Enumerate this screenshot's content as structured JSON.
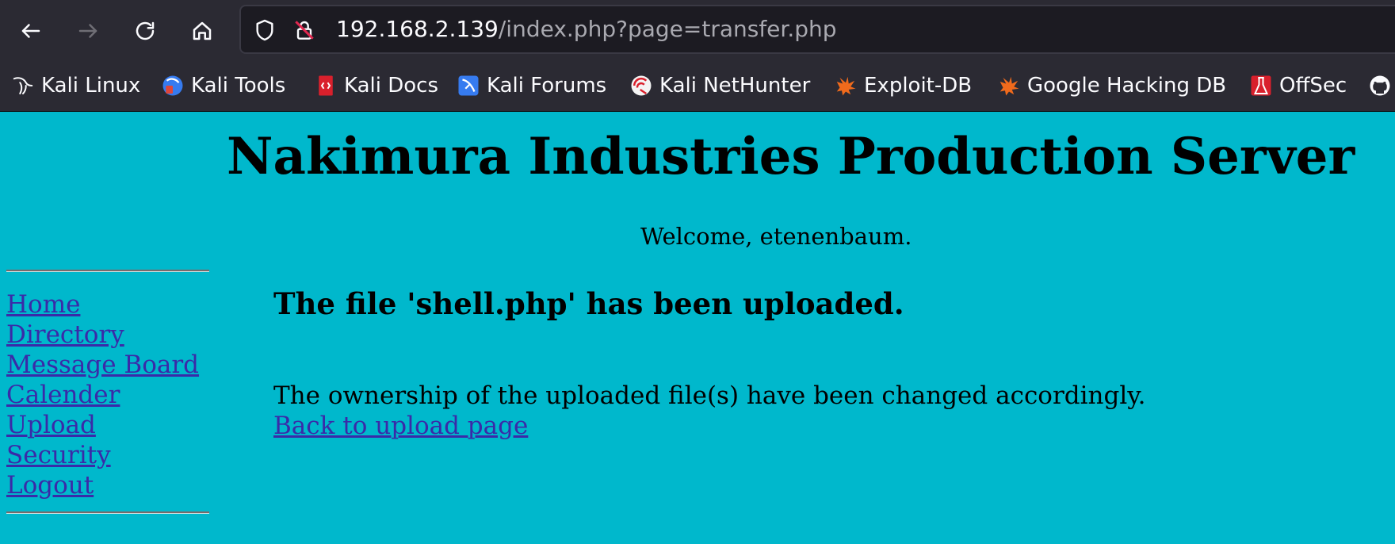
{
  "browser": {
    "url_host": "192.168.2.139",
    "url_path": "/index.php?page=transfer.php",
    "bookmarks": [
      {
        "label": "Kali Linux",
        "icon": "kali-dragon-icon"
      },
      {
        "label": "Kali Tools",
        "icon": "kali-tools-icon"
      },
      {
        "label": "Kali Docs",
        "icon": "kali-docs-icon"
      },
      {
        "label": "Kali Forums",
        "icon": "kali-forums-icon"
      },
      {
        "label": "Kali NetHunter",
        "icon": "kali-nethunter-icon"
      },
      {
        "label": "Exploit-DB",
        "icon": "exploit-db-icon"
      },
      {
        "label": "Google Hacking DB",
        "icon": "ghdb-icon"
      },
      {
        "label": "OffSec",
        "icon": "offsec-icon"
      }
    ]
  },
  "page": {
    "title": "Nakimura Industries Production Server",
    "welcome": "Welcome, etenenbaum.",
    "nav": [
      {
        "label": "Home"
      },
      {
        "label": "Directory"
      },
      {
        "label": "Message Board"
      },
      {
        "label": "Calender"
      },
      {
        "label": "Upload"
      },
      {
        "label": "Security"
      },
      {
        "label": "Logout"
      }
    ],
    "upload_message": "The file 'shell.php' has been uploaded.",
    "ownership_message": "The ownership of the uploaded file(s) have been changed accordingly.",
    "back_link": "Back to upload page"
  },
  "colors": {
    "page_background": "#00b8cc",
    "link": "#3a2aa8",
    "chrome_background": "#2b2a33"
  }
}
